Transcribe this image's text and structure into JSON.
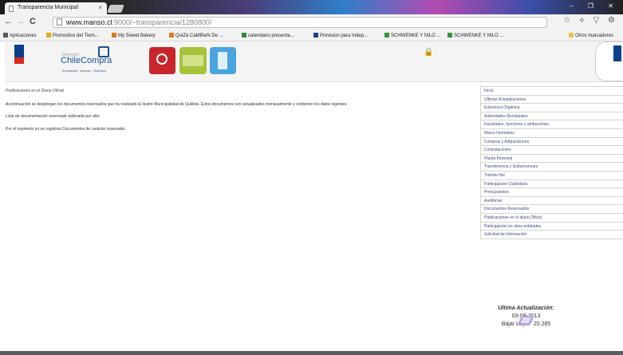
{
  "browser": {
    "tab_title": "Transparencia Municipal",
    "tab_close": "×",
    "url_host": "www.manso.cl",
    "url_rest": ":9000/~transparencia/1280800/",
    "window_controls": "– ❐ ✕",
    "toolbar_icons": "☆ ⟡ ▽ ⚙",
    "star": "☆",
    "back": "←",
    "forward": "→",
    "reload": "C"
  },
  "bookmarks": [
    {
      "label": "Aplicaciones",
      "color": "#5a5a5a"
    },
    {
      "label": "Pronostico del Tiem...",
      "color": "#e6a817"
    },
    {
      "label": "My Sweet Bakery",
      "color": "#e07a1f"
    },
    {
      "label": "QuiZá CaMBieN De ...",
      "color": "#e07a1f"
    },
    {
      "label": "calendario presenta...",
      "color": "#2d8a3e"
    },
    {
      "label": "Prevision para Indep...",
      "color": "#1b3f8f"
    },
    {
      "label": "SCHWENKE Y NILO ...",
      "color": "#2b9a3b"
    },
    {
      "label": "SCHWENKE Y NILO ...",
      "color": "#2b9a3b"
    },
    {
      "label": "Otros marcadores",
      "color": "#e6c24a"
    }
  ],
  "header": {
    "cc_pre": "Dirección",
    "cc_name": "ChileCompra",
    "cc_sub": "Innovación · Acceso · Solución"
  },
  "content": {
    "heading": "Publicaciones en el Diario Oficial",
    "intro": "Acontinuación se despliegan los documentos reservados que ha realizado la Ilustre Municipalidad de Quillota. Estos documentos son actualizados mensualmente y contienen los datos vigentes.",
    "list_title": "Lista de documentación reservada ordenada por año:",
    "none": "Por el momento no se registran Documentos de carácter reservado."
  },
  "menu": [
    "Inicio",
    "Ultimas Actualizaciones",
    "Estructura Orgánica",
    "Autoridades Municipales",
    "Facultades, funciones y atribuciones",
    "Marco Normativo",
    "Compras y Adquisiciones",
    "Contrataciones",
    "Planta Personal",
    "Transferencia y Subvenciones",
    "Trámite Nol",
    "Participación Ciudadana",
    "Presupuestos",
    "Auditorías",
    "Documentos Reservados",
    "Publicaciones en el diario Oficial",
    "Participación en otras entidades",
    "Solicitud de Información"
  ],
  "update": {
    "label": "Ultima Actualización:",
    "date": "03-08-2013",
    "law": "Bajar Ley n° 20.285"
  }
}
